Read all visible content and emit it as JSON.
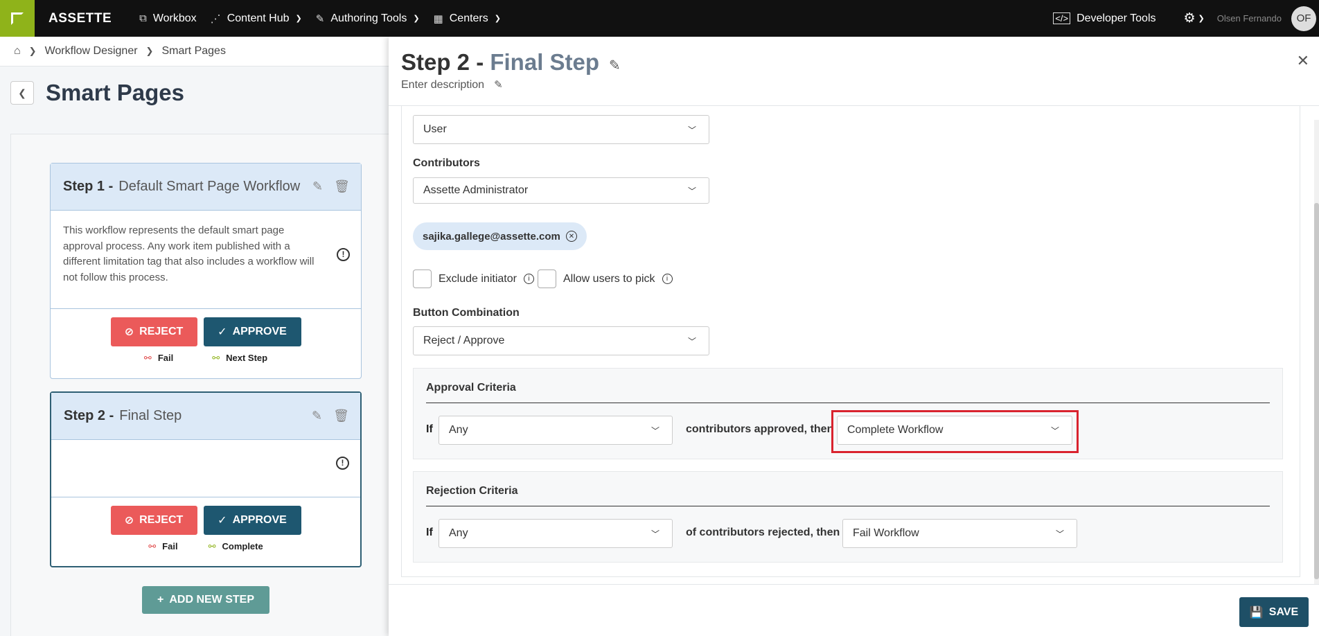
{
  "nav": {
    "brand": "ASSETTE",
    "items": [
      {
        "label": "Workbox",
        "icon": "workbox-icon",
        "glyph": "⧉"
      },
      {
        "label": "Content Hub",
        "icon": "share-icon",
        "glyph": "⋰"
      },
      {
        "label": "Authoring Tools",
        "icon": "edit-icon",
        "glyph": "✎"
      },
      {
        "label": "Centers",
        "icon": "building-icon",
        "glyph": "▦"
      }
    ],
    "developer_tools": "Developer Tools",
    "user_name": "Olsen Fernando",
    "avatar_initials": "OF"
  },
  "breadcrumb": [
    "Workflow Designer",
    "Smart Pages"
  ],
  "page": {
    "title": "Smart Pages"
  },
  "steps": [
    {
      "number": "Step 1 -",
      "name": "Default Smart Page Workflow",
      "description": "This workflow represents the default smart page approval process. Any work item published with a different limitation tag that also includes a workflow will not follow this process.",
      "reject_label": "REJECT",
      "approve_label": "APPROVE",
      "reject_outcome": "Fail",
      "approve_outcome": "Next Step"
    },
    {
      "number": "Step 2 -",
      "name": "Final Step",
      "description": "",
      "reject_label": "REJECT",
      "approve_label": "APPROVE",
      "reject_outcome": "Fail",
      "approve_outcome": "Complete"
    }
  ],
  "add_step_label": "ADD NEW STEP",
  "panel": {
    "title_prefix": "Step 2 - ",
    "title_name": "Final Step",
    "description": "Enter description",
    "contributor_type_value": "User",
    "contributors_label": "Contributors",
    "contributors_value": "Assette Administrator",
    "chip_email": "sajika.gallege@assette.com",
    "exclude_initiator_label": "Exclude initiator",
    "allow_users_label": "Allow users to pick",
    "button_combination_label": "Button Combination",
    "button_combination_value": "Reject / Approve",
    "approval": {
      "title": "Approval Criteria",
      "if_label": "If",
      "count_value": "Any",
      "middle_text": "contributors approved, then",
      "action_value": "Complete Workflow"
    },
    "rejection": {
      "title": "Rejection Criteria",
      "if_label": "If",
      "count_value": "Any",
      "middle_text": "of contributors rejected, then",
      "action_value": "Fail Workflow"
    },
    "save_label": "SAVE"
  },
  "colors": {
    "brand_green": "#8fb31a",
    "reject_red": "#eb5a5a",
    "approve_teal": "#1e5770",
    "highlight_red": "#d9232e"
  }
}
